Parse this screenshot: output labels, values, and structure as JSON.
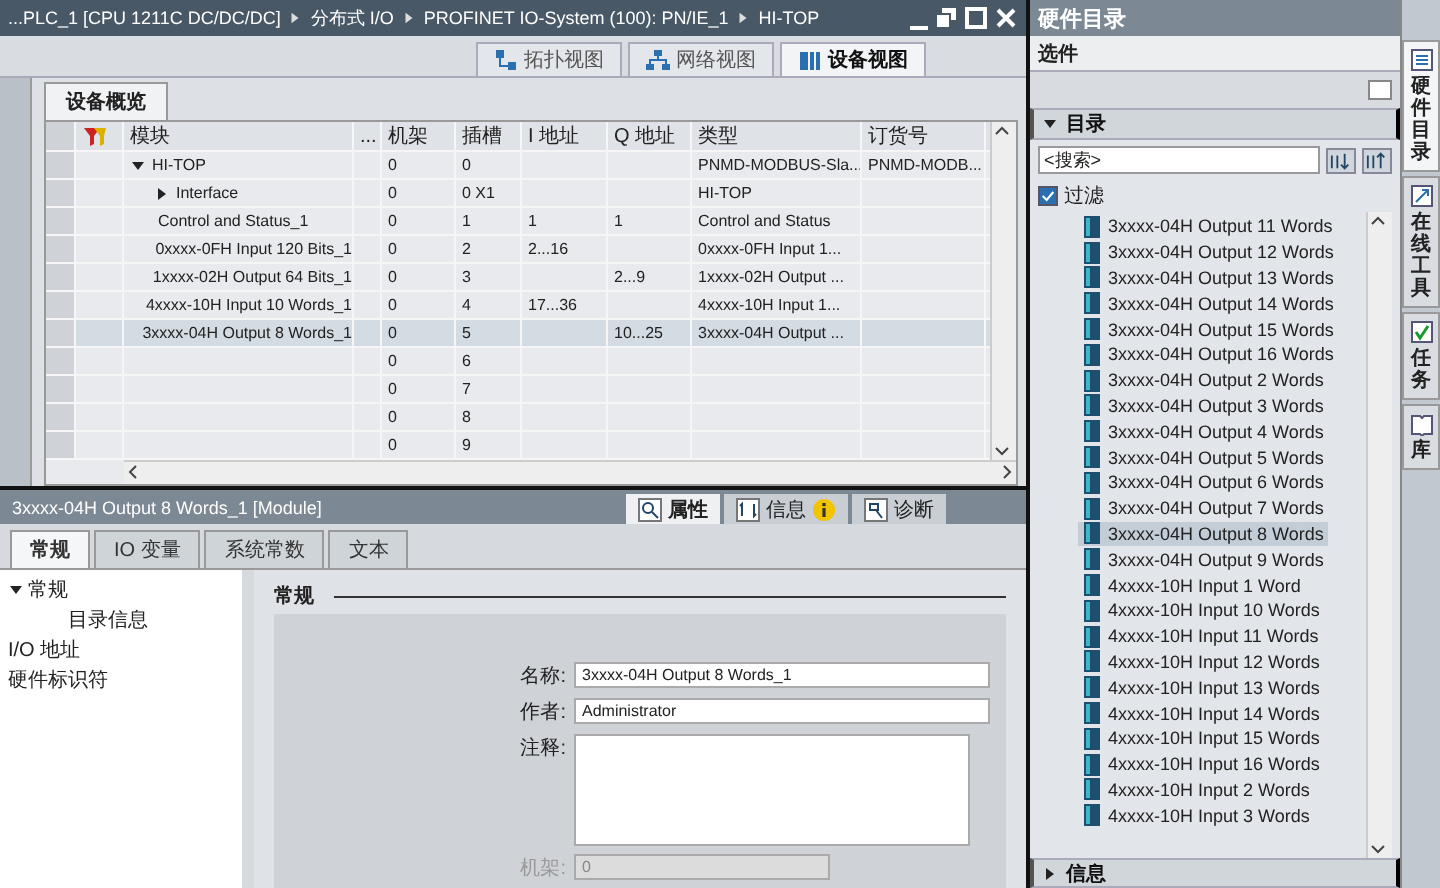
{
  "breadcrumb": [
    "...PLC_1 [CPU 1211C DC/DC/DC]",
    "分布式 I/O",
    "PROFINET IO-System (100): PN/IE_1",
    "HI-TOP"
  ],
  "view_tabs": [
    {
      "label": "拓扑视图",
      "selected": false,
      "kind": "topology"
    },
    {
      "label": "网络视图",
      "selected": false,
      "kind": "network"
    },
    {
      "label": "设备视图",
      "selected": true,
      "kind": "device"
    }
  ],
  "overview_tab": "设备概览",
  "table": {
    "columns": [
      "模块",
      "...",
      "机架",
      "插槽",
      "I 地址",
      "Q 地址",
      "类型",
      "订货号"
    ],
    "rows": [
      {
        "module": "HI-TOP",
        "rack": "0",
        "slot": "0",
        "type": "PNMD-MODBUS-Sla...",
        "order": "PNMD-MODB...",
        "selected": false,
        "expanded": true,
        "children": [
          {
            "module": "Interface",
            "rack": "0",
            "slot": "0 X1",
            "type": "HI-TOP",
            "selected": false,
            "expanded": false
          }
        ]
      },
      {
        "module": "Control and Status_1",
        "rack": "0",
        "slot": "1",
        "i_address": "1",
        "q_address": "1",
        "type": "Control and Status",
        "selected": false
      },
      {
        "module": "0xxxx-0FH Input 120 Bits_1",
        "rack": "0",
        "slot": "2",
        "i_address": "2...16",
        "type": "0xxxx-0FH Input 1...",
        "selected": false
      },
      {
        "module": "1xxxx-02H Output 64 Bits_1",
        "rack": "0",
        "slot": "3",
        "q_address": "2...9",
        "type": "1xxxx-02H Output ...",
        "selected": false
      },
      {
        "module": "4xxxx-10H Input 10 Words_1",
        "rack": "0",
        "slot": "4",
        "i_address": "17...36",
        "type": "4xxxx-10H Input 1...",
        "selected": false
      },
      {
        "module": "3xxxx-04H Output 8 Words_1",
        "rack": "0",
        "slot": "5",
        "q_address": "10...25",
        "type": "3xxxx-04H Output ...",
        "selected": true
      },
      {
        "rack": "0",
        "slot": "6",
        "selected": false
      },
      {
        "rack": "0",
        "slot": "7",
        "selected": false
      },
      {
        "rack": "0",
        "slot": "8",
        "selected": false
      },
      {
        "rack": "0",
        "slot": "9",
        "selected": false
      }
    ]
  },
  "inspector": {
    "title": "3xxxx-04H Output 8 Words_1 [Module]",
    "tabs": [
      {
        "label": "属性",
        "selected": true,
        "kind": "properties"
      },
      {
        "label": "信息",
        "selected": false,
        "kind": "info"
      },
      {
        "label": "诊断",
        "selected": false,
        "kind": "diagnostics"
      }
    ],
    "property_tabs": [
      {
        "label": "常规",
        "selected": true
      },
      {
        "label": "IO 变量",
        "selected": false
      },
      {
        "label": "系统常数",
        "selected": false
      },
      {
        "label": "文本",
        "selected": false
      }
    ],
    "nav": [
      {
        "label": "常规",
        "expanded": true,
        "children": [
          {
            "label": "目录信息"
          }
        ]
      },
      {
        "label": "I/O 地址"
      },
      {
        "label": "硬件标识符"
      }
    ],
    "section_title": "常规",
    "fields": [
      {
        "label": "名称:",
        "value": "3xxxx-04H Output 8 Words_1",
        "kind": "text",
        "disabled": false
      },
      {
        "label": "作者:",
        "value": "Administrator",
        "kind": "text",
        "disabled": false
      },
      {
        "label": "注释:",
        "kind": "textarea",
        "disabled": false
      },
      {
        "label": "机架:",
        "value": "0",
        "kind": "text",
        "disabled": true
      }
    ]
  },
  "catalog": {
    "title": "硬件目录",
    "options_title": "选件",
    "section": {
      "label": "目录",
      "expanded": true
    },
    "search": {
      "placeholder": "<搜索>"
    },
    "filter": {
      "label": "过滤",
      "checked": true
    },
    "items": [
      {
        "label": "3xxxx-04H Output 11 Words",
        "selected": false
      },
      {
        "label": "3xxxx-04H Output 12 Words",
        "selected": false
      },
      {
        "label": "3xxxx-04H Output 13 Words",
        "selected": false
      },
      {
        "label": "3xxxx-04H Output 14 Words",
        "selected": false
      },
      {
        "label": "3xxxx-04H Output 15 Words",
        "selected": false
      },
      {
        "label": "3xxxx-04H Output 16 Words",
        "selected": false
      },
      {
        "label": "3xxxx-04H Output 2 Words",
        "selected": false
      },
      {
        "label": "3xxxx-04H Output 3 Words",
        "selected": false
      },
      {
        "label": "3xxxx-04H Output 4 Words",
        "selected": false
      },
      {
        "label": "3xxxx-04H Output 5 Words",
        "selected": false
      },
      {
        "label": "3xxxx-04H Output 6 Words",
        "selected": false
      },
      {
        "label": "3xxxx-04H Output 7 Words",
        "selected": false
      },
      {
        "label": "3xxxx-04H Output 8 Words",
        "selected": true
      },
      {
        "label": "3xxxx-04H Output 9 Words",
        "selected": false
      },
      {
        "label": "4xxxx-10H Input 1 Word",
        "selected": false
      },
      {
        "label": "4xxxx-10H Input 10 Words",
        "selected": false
      },
      {
        "label": "4xxxx-10H Input 11 Words",
        "selected": false
      },
      {
        "label": "4xxxx-10H Input 12 Words",
        "selected": false
      },
      {
        "label": "4xxxx-10H Input 13 Words",
        "selected": false
      },
      {
        "label": "4xxxx-10H Input 14 Words",
        "selected": false
      },
      {
        "label": "4xxxx-10H Input 15 Words",
        "selected": false
      },
      {
        "label": "4xxxx-10H Input 16 Words",
        "selected": false
      },
      {
        "label": "4xxxx-10H Input 2 Words",
        "selected": false
      },
      {
        "label": "4xxxx-10H Input 3 Words",
        "selected": false
      }
    ],
    "info_section": {
      "label": "信息",
      "expanded": false
    }
  },
  "side_tabs": [
    {
      "label": "硬件目录",
      "selected": true,
      "kind": "catalog"
    },
    {
      "label": "在线工具",
      "selected": false,
      "kind": "online"
    },
    {
      "label": "任务",
      "selected": false,
      "kind": "tasks"
    },
    {
      "label": "库",
      "selected": false,
      "kind": "library"
    }
  ]
}
